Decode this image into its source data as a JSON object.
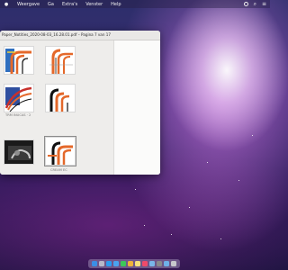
{
  "menubar": {
    "items": [
      "Weergave",
      "Ga",
      "Extra's",
      "Venster",
      "Help"
    ]
  },
  "window": {
    "title": "Paper_Notities_2020-08-03_16.28.01.pdf – Pagina 7 van 17"
  },
  "thumbnails": [
    {
      "label": ""
    },
    {
      "label": ""
    },
    {
      "label": ""
    },
    {
      "label": ""
    },
    {
      "label": "TRM INUCAS · 2"
    },
    {
      "label": ""
    },
    {
      "label": "CREAM EC"
    }
  ],
  "dock": {
    "apps": [
      "finder",
      "launchpad",
      "safari",
      "mail",
      "messages",
      "photos",
      "notes",
      "music",
      "preview",
      "settings",
      "folder",
      "trash"
    ]
  },
  "colors": {
    "accent_orange": "#e4682a",
    "accent_black": "#111111",
    "accent_blue": "#2f6fbf",
    "accent_red": "#c8302b"
  }
}
